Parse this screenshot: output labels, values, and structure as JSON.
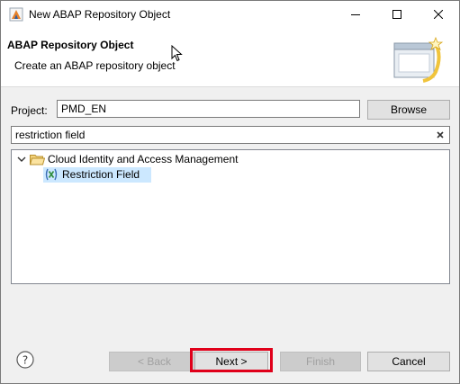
{
  "window": {
    "title": "New ABAP Repository Object",
    "controls": [
      "minimize-icon",
      "maximize-icon",
      "close-icon"
    ]
  },
  "banner": {
    "title": "ABAP Repository Object",
    "subtitle": "Create an ABAP repository object"
  },
  "project": {
    "label": "Project:",
    "value": "PMD_EN",
    "browse_label": "Browse"
  },
  "filter": {
    "value": "restriction field",
    "clear_icon": "clear-icon"
  },
  "tree": {
    "category": {
      "label": "Cloud Identity and Access Management",
      "icon": "folder-open-icon",
      "expanded": true
    },
    "item": {
      "label": "Restriction Field",
      "icon": "restriction-field-icon",
      "selected": true
    }
  },
  "footer": {
    "back_label": "< Back",
    "next_label": "Next >",
    "finish_label": "Finish",
    "cancel_label": "Cancel",
    "help_icon": "help-icon"
  },
  "colors": {
    "highlight_border": "#e0001a",
    "selection": "#cce8ff",
    "folder": "#e8b84a"
  }
}
